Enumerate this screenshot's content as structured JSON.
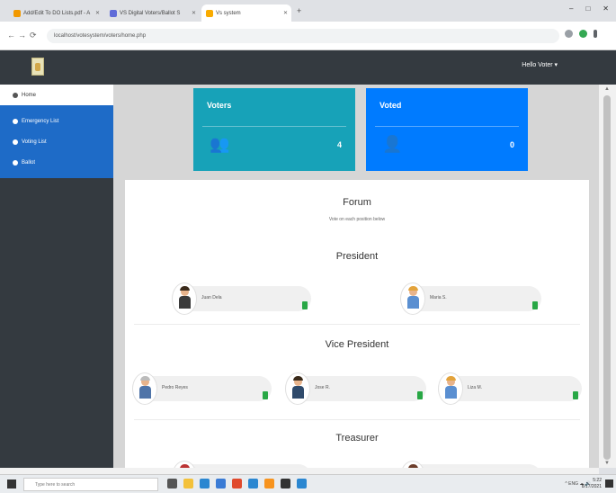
{
  "browser": {
    "tabs": [
      {
        "label": "Add/Edit To DO Lists.pdf - A",
        "color": "#f29900"
      },
      {
        "label": "VS Digital Voters/Ballot S",
        "color": "#5f6bd8"
      },
      {
        "label": "Vs system",
        "color": "#f9ab00"
      }
    ],
    "new_tab": "+",
    "url": "localhost/votesystem/voters/home.php",
    "win_ctrls": [
      "–",
      "□",
      "✕"
    ]
  },
  "header": {
    "user_label": "Hello Voter ▾"
  },
  "sidebar": {
    "items": [
      {
        "label": "Home"
      },
      {
        "label": "Emergency List"
      },
      {
        "label": "Voting List"
      },
      {
        "label": "Ballot"
      }
    ]
  },
  "cards": {
    "voters": {
      "title": "Voters",
      "count": "4",
      "icon": "👥"
    },
    "voted": {
      "title": "Voted",
      "count": "0",
      "icon": "👤"
    }
  },
  "panel": {
    "title": "Forum",
    "subtitle": "Vote on each position below",
    "sections": [
      {
        "title": "President",
        "candidates": [
          {
            "name": "Juan Dela",
            "hair": "#3a2a1a",
            "body": "#3b3b3b"
          },
          {
            "name": "Maria S.",
            "hair": "#e3a33b",
            "body": "#5a8fd1"
          }
        ]
      },
      {
        "title": "Vice President",
        "candidates": [
          {
            "name": "Pedro Reyes",
            "hair": "#bbbbbb",
            "body": "#4f74a8"
          },
          {
            "name": "Jose R.",
            "hair": "#3a2a1a",
            "body": "#2f4a6b"
          },
          {
            "name": "Liza M.",
            "hair": "#e3a33b",
            "body": "#5a8fd1"
          }
        ]
      },
      {
        "title": "Treasurer",
        "candidates": []
      }
    ]
  },
  "taskbar": {
    "search_placeholder": "Type here to search",
    "tray": "^  ENG  ☁  🔊",
    "time": "5:22",
    "date": "8/17/2021",
    "icons": [
      {
        "name": "task-view-icon",
        "color": "#555555"
      },
      {
        "name": "file-explorer-icon",
        "color": "#f3c13a"
      },
      {
        "name": "edge-icon",
        "color": "#2b87d1"
      },
      {
        "name": "store-icon",
        "color": "#3a7bd5"
      },
      {
        "name": "chrome-icon",
        "color": "#e04a2d"
      },
      {
        "name": "mail-icon",
        "color": "#2b87d1"
      },
      {
        "name": "xampp-icon",
        "color": "#f7931e"
      },
      {
        "name": "terminal-icon",
        "color": "#333333"
      },
      {
        "name": "vscode-icon",
        "color": "#2b87d1"
      }
    ]
  }
}
